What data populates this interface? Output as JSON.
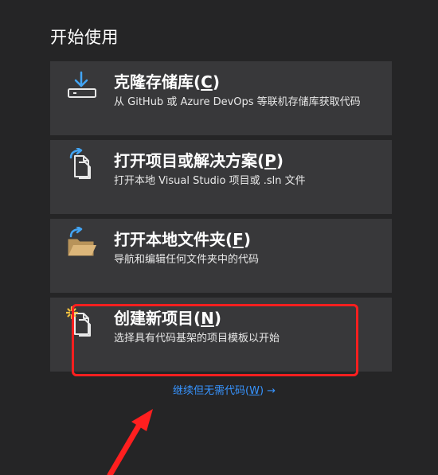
{
  "section": {
    "title": "开始使用"
  },
  "cards": [
    {
      "title_text": "克隆存储库(",
      "mnemonic": "C",
      "title_close": ")",
      "description": "从 GitHub 或 Azure DevOps 等联机存储库获取代码",
      "icon": "clone-download-icon"
    },
    {
      "title_text": "打开项目或解决方案(",
      "mnemonic": "P",
      "title_close": ")",
      "description": "打开本地 Visual Studio 项目或 .sln 文件",
      "icon": "open-project-icon"
    },
    {
      "title_text": "打开本地文件夹(",
      "mnemonic": "F",
      "title_close": ")",
      "description": "导航和编辑任何文件夹中的代码",
      "icon": "open-folder-icon"
    },
    {
      "title_text": "创建新项目(",
      "mnemonic": "N",
      "title_close": ")",
      "description": "选择具有代码基架的项目模板以开始",
      "icon": "new-project-icon"
    }
  ],
  "continue_link": {
    "text": "继续但无需代码(",
    "mnemonic": "W",
    "close": ")",
    "arrow": "→"
  },
  "colors": {
    "background": "#252526",
    "card": "#38383a",
    "link": "#3794ff",
    "icon_blue": "#42a5f5",
    "folder_orange": "#dcb67a",
    "annotation_red": "#ff1f1f"
  }
}
